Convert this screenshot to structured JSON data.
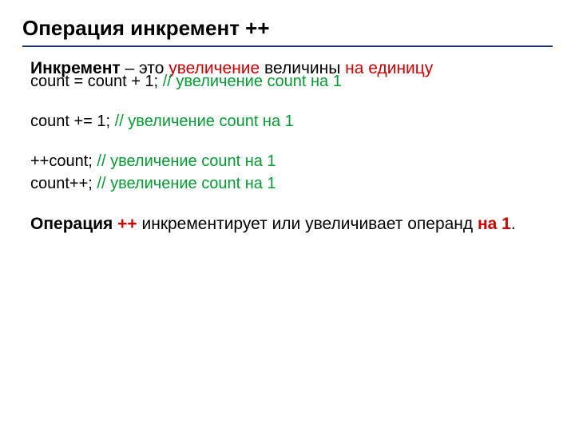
{
  "title": "Операция инкремент    ++",
  "intro": {
    "part1_bold": "Инкремент",
    "part2": " – это ",
    "part3_red": "увеличение",
    "part4": " величины ",
    "part5_red": "на единицу"
  },
  "lines": {
    "l1_code": "count = count + 1; ",
    "l1_comment": "// увеличение count на 1",
    "l2_code": "count += 1;   ",
    "l2_comment": "// увеличение count на 1",
    "l3_code": "++count; ",
    "l3_comment": "// увеличение count на 1",
    "l4_code": "count++; ",
    "l4_comment": "// увеличение count на 1"
  },
  "summary": {
    "s1_bold": "Операция ",
    "s2_redbold": "++",
    "s3": " инкрементирует или увеличивает операнд ",
    "s4_redbold": "на 1",
    "s5": "."
  }
}
